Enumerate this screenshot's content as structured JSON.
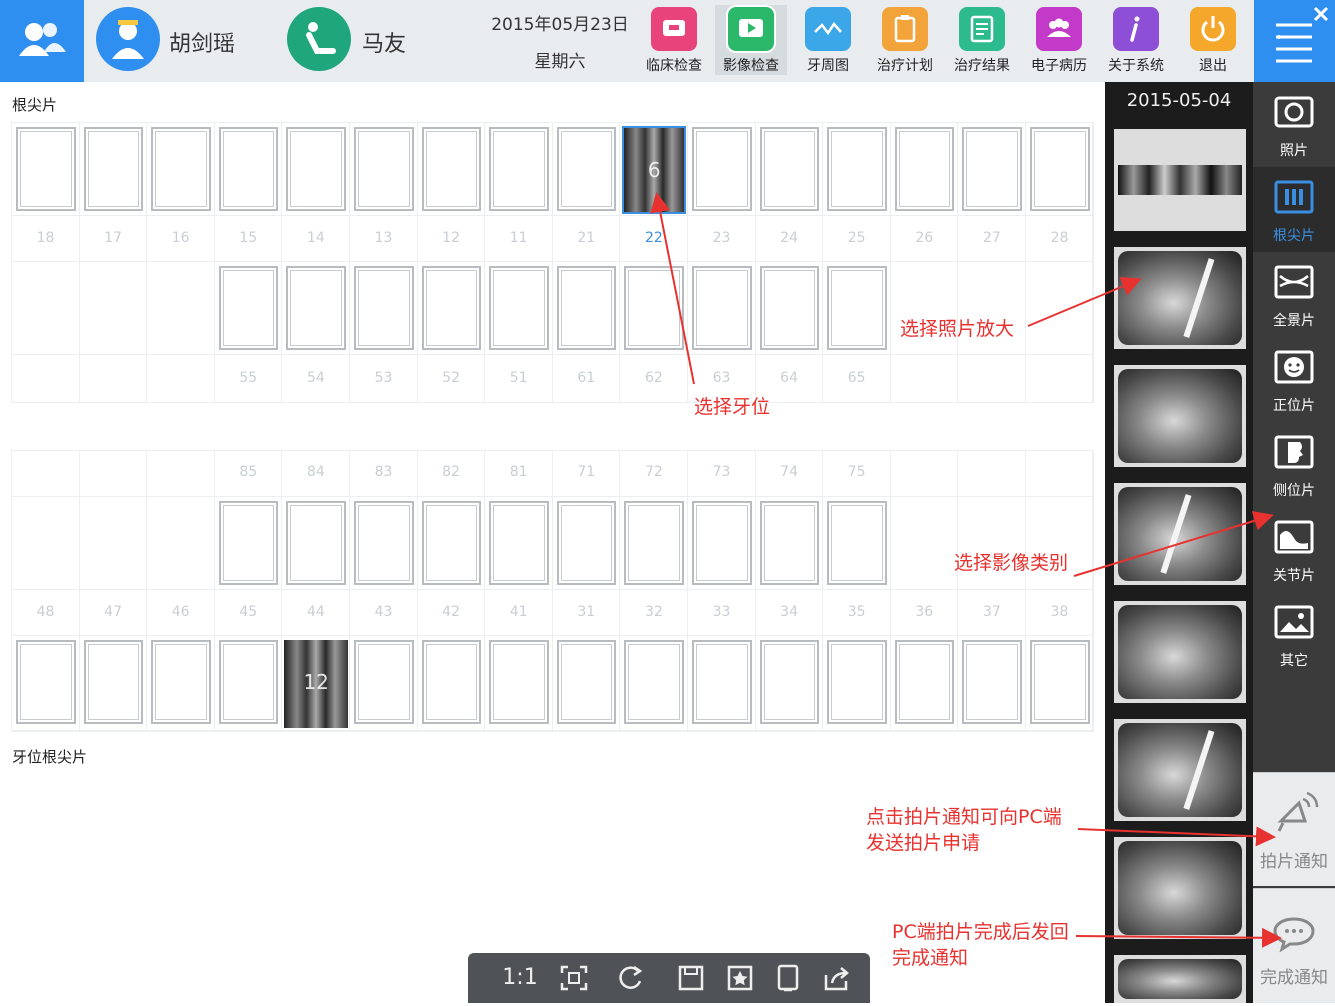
{
  "header": {
    "doctor_name": "胡剑瑶",
    "patient_name": "马友",
    "date": "2015年05月23日",
    "weekday": "星期六",
    "tools": [
      {
        "label": "临床检查",
        "icon": "id-card-icon",
        "color": "#e8437a"
      },
      {
        "label": "影像检查",
        "icon": "play-screen-icon",
        "color": "#2bb86a"
      },
      {
        "label": "牙周图",
        "icon": "wave-chart-icon",
        "color": "#3ba7e8"
      },
      {
        "label": "治疗计划",
        "icon": "clipboard-icon",
        "color": "#f2a33a"
      },
      {
        "label": "治疗结果",
        "icon": "document-list-icon",
        "color": "#2dbb8e"
      },
      {
        "label": "电子病历",
        "icon": "people-group-icon",
        "color": "#c43ac8"
      },
      {
        "label": "关于系统",
        "icon": "info-icon",
        "color": "#8c4fd6"
      },
      {
        "label": "退出",
        "icon": "power-icon",
        "color": "#f4a72a"
      }
    ]
  },
  "main": {
    "section_title": "根尖片",
    "bottom_section_title": "牙位根尖片",
    "upper_permanent": [
      "18",
      "17",
      "16",
      "15",
      "14",
      "13",
      "12",
      "11",
      "21",
      "22",
      "23",
      "24",
      "25",
      "26",
      "27",
      "28"
    ],
    "upper_primary": [
      "55",
      "54",
      "53",
      "52",
      "51",
      "61",
      "62",
      "63",
      "64",
      "65"
    ],
    "lower_primary": [
      "85",
      "84",
      "83",
      "82",
      "81",
      "71",
      "72",
      "73",
      "74",
      "75"
    ],
    "lower_permanent": [
      "48",
      "47",
      "46",
      "45",
      "44",
      "43",
      "42",
      "41",
      "31",
      "32",
      "33",
      "34",
      "35",
      "36",
      "37",
      "38"
    ],
    "selected_tooth": "22",
    "image_counts": {
      "tooth_22": "6",
      "tooth_44": "12"
    }
  },
  "thumbnails": {
    "date": "2015-05-04"
  },
  "categories": [
    {
      "label": "照片",
      "icon": "camera-icon"
    },
    {
      "label": "根尖片",
      "icon": "periapical-icon"
    },
    {
      "label": "全景片",
      "icon": "panoramic-icon"
    },
    {
      "label": "正位片",
      "icon": "face-front-icon"
    },
    {
      "label": "侧位片",
      "icon": "face-side-icon"
    },
    {
      "label": "关节片",
      "icon": "joint-icon"
    },
    {
      "label": "其它",
      "icon": "image-icon"
    }
  ],
  "notifications": {
    "shoot_label": "拍片通知",
    "done_label": "完成通知"
  },
  "toolbar": {
    "actual_size": "1:1"
  },
  "annotations": {
    "select_photo": "选择照片放大",
    "select_tooth": "选择牙位",
    "select_category": "选择影像类别",
    "shoot_notice_line1": "点击拍片通知可向PC端",
    "shoot_notice_line2": "发送拍片申请",
    "done_notice_line1": "PC端拍片完成后发回",
    "done_notice_line2": "完成通知"
  }
}
